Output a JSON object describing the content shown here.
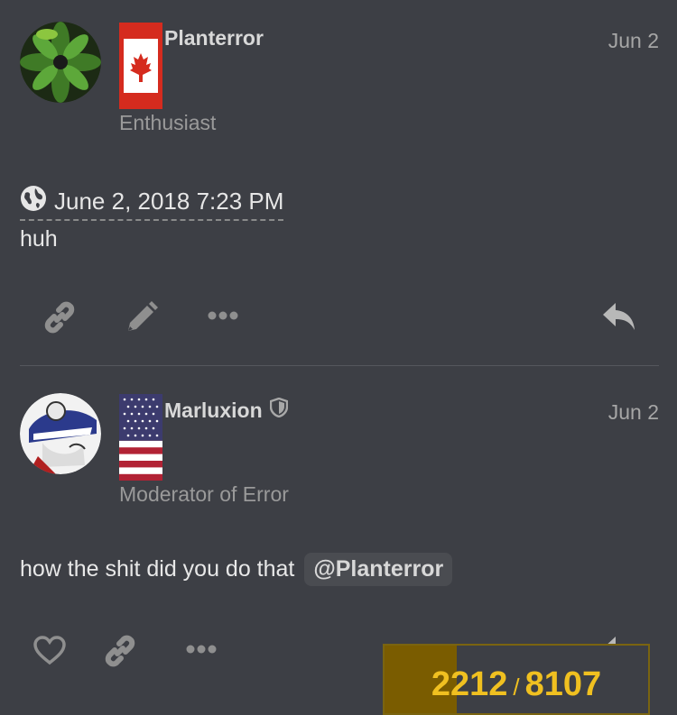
{
  "posts": [
    {
      "username": "Planterror",
      "date": "Jun 2",
      "user_title": "Enthusiast",
      "flag": "canada-flag",
      "timestamp": "June 2, 2018 7:23 PM",
      "body": "huh",
      "actions": [
        "link-icon",
        "pencil-icon",
        "more-icon",
        "reply-icon"
      ]
    },
    {
      "username": "Marluxion",
      "date": "Jun 2",
      "user_title": "Moderator of Error",
      "flag": "usa-flag",
      "body_prefix": "how the shit did you do that",
      "mention": "@Planterror",
      "actions": [
        "heart-icon",
        "link-icon",
        "more-icon",
        "reply-icon"
      ]
    }
  ],
  "progress": {
    "current": "2212",
    "separator": "/",
    "total": "8107",
    "fraction": 0.273
  },
  "colors": {
    "background": "#3d3f45",
    "progress_text": "#f0c020",
    "progress_fill": "#7a5c00"
  }
}
